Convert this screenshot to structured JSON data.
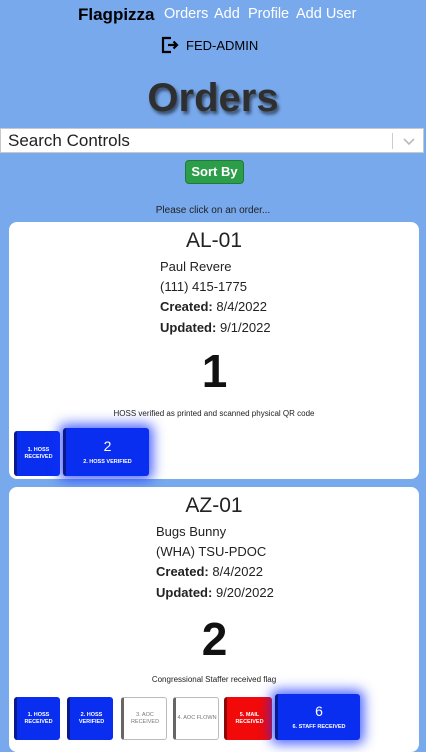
{
  "nav": {
    "brand": "Flagpizza",
    "links": [
      "Orders",
      "Add",
      "Profile",
      "Add User"
    ],
    "user": "FED-ADMIN"
  },
  "page_title": "Orders",
  "search": {
    "label": "Search Controls"
  },
  "sort_label": "Sort By",
  "hint": "Please click on an order...",
  "orders": [
    {
      "id": "AL-01",
      "name": "Paul Revere",
      "contact": "(111) 415-1775",
      "created_label": "Created:",
      "created": "8/4/2022",
      "updated_label": "Updated:",
      "updated": "9/1/2022",
      "status_num": "1",
      "status_text": "HOSS verified as printed and scanned physical QR code",
      "stages": [
        {
          "l1": "1. HOSS",
          "l2": "RECEIVED"
        },
        {
          "num": "2",
          "l1": "2. HOSS VERIFIED"
        }
      ]
    },
    {
      "id": "AZ-01",
      "name": "Bugs Bunny",
      "contact": "(WHA) TSU-PDOC",
      "created_label": "Created:",
      "created": "8/4/2022",
      "updated_label": "Updated:",
      "updated": "9/20/2022",
      "status_num": "2",
      "status_text": "Congressional Staffer received flag",
      "stages": [
        {
          "l1": "1. HOSS",
          "l2": "RECEIVED"
        },
        {
          "l1": "2. HOSS",
          "l2": "VERIFIED"
        },
        {
          "l1": "3. AOC",
          "l2": "RECEIVED"
        },
        {
          "l1": "4. AOC FLOWN"
        },
        {
          "l1": "5. MAIL",
          "l2": "RECEIVED"
        },
        {
          "num": "6",
          "l1": "6. STAFF RECEIVED"
        }
      ]
    }
  ],
  "colors": {
    "background": "#78a9ec",
    "stage_done": "#0a2ef0",
    "stage_pending": "#ffffff",
    "stage_mail": "#f20a0a",
    "sort_button": "#2c9e4a"
  },
  "icons": {
    "logout": "logout-icon",
    "dropdown": "chevron-down-icon"
  }
}
